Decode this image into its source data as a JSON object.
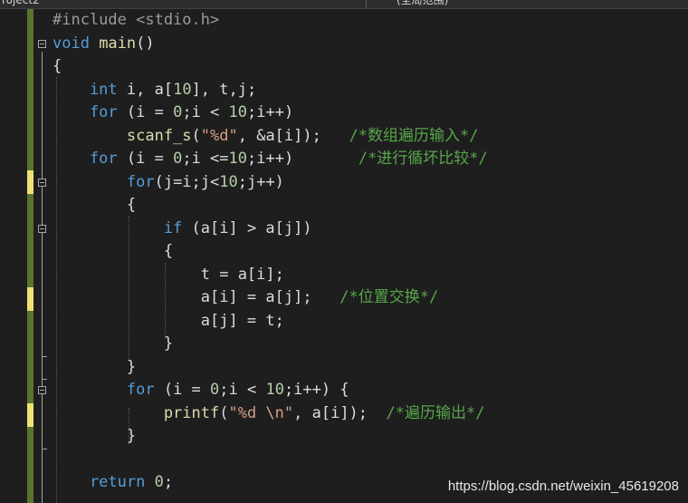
{
  "window": {
    "tab_left": "roject2",
    "tab_right": "(全局范围)"
  },
  "code_lines": [
    [
      {
        "t": "#include <stdio.h>",
        "c": "pp"
      }
    ],
    [
      {
        "t": "void",
        "c": "kw"
      },
      {
        "t": " main",
        "c": "fn"
      },
      {
        "t": "()",
        "c": "var"
      }
    ],
    [
      {
        "t": "{",
        "c": "var"
      }
    ],
    [
      {
        "t": "    int",
        "c": "kw"
      },
      {
        "t": " i, a[",
        "c": "var"
      },
      {
        "t": "10",
        "c": "num"
      },
      {
        "t": "], t,j;",
        "c": "var"
      }
    ],
    [
      {
        "t": "    for",
        "c": "kw"
      },
      {
        "t": " (i = ",
        "c": "var"
      },
      {
        "t": "0",
        "c": "num"
      },
      {
        "t": ";i < ",
        "c": "var"
      },
      {
        "t": "10",
        "c": "num"
      },
      {
        "t": ";i++)",
        "c": "var"
      }
    ],
    [
      {
        "t": "        scanf_s",
        "c": "fn"
      },
      {
        "t": "(",
        "c": "var"
      },
      {
        "t": "\"%d\"",
        "c": "str"
      },
      {
        "t": ", &a[i]);   ",
        "c": "var"
      },
      {
        "t": "/*数组遍历输入*/",
        "c": "com"
      }
    ],
    [
      {
        "t": "    for",
        "c": "kw"
      },
      {
        "t": " (i = ",
        "c": "var"
      },
      {
        "t": "0",
        "c": "num"
      },
      {
        "t": ";i <=",
        "c": "var"
      },
      {
        "t": "10",
        "c": "num"
      },
      {
        "t": ";i++)       ",
        "c": "var"
      },
      {
        "t": "/*进行循坏比较*/",
        "c": "com"
      }
    ],
    [
      {
        "t": "        for",
        "c": "kw"
      },
      {
        "t": "(j=i;j<",
        "c": "var"
      },
      {
        "t": "10",
        "c": "num"
      },
      {
        "t": ";j++)",
        "c": "var"
      }
    ],
    [
      {
        "t": "        {",
        "c": "var"
      }
    ],
    [
      {
        "t": "            if",
        "c": "kw"
      },
      {
        "t": " (a[i] > a[j])",
        "c": "var"
      }
    ],
    [
      {
        "t": "            {",
        "c": "var"
      }
    ],
    [
      {
        "t": "                t = a[i];",
        "c": "var"
      }
    ],
    [
      {
        "t": "                a[i] = a[j];   ",
        "c": "var"
      },
      {
        "t": "/*位置交换*/",
        "c": "com"
      }
    ],
    [
      {
        "t": "                a[j] = t;",
        "c": "var"
      }
    ],
    [
      {
        "t": "            }",
        "c": "var"
      }
    ],
    [
      {
        "t": "        }",
        "c": "var"
      }
    ],
    [
      {
        "t": "        for",
        "c": "kw"
      },
      {
        "t": " (i = ",
        "c": "var"
      },
      {
        "t": "0",
        "c": "num"
      },
      {
        "t": ";i < ",
        "c": "var"
      },
      {
        "t": "10",
        "c": "num"
      },
      {
        "t": ";i++) {",
        "c": "var"
      }
    ],
    [
      {
        "t": "            printf",
        "c": "fn"
      },
      {
        "t": "(",
        "c": "var"
      },
      {
        "t": "\"%d \\n\"",
        "c": "str"
      },
      {
        "t": ", a[i]);  ",
        "c": "var"
      },
      {
        "t": "/*遍历输出*/",
        "c": "com"
      }
    ],
    [
      {
        "t": "        }",
        "c": "var"
      }
    ],
    [
      {
        "t": "",
        "c": "var"
      }
    ],
    [
      {
        "t": "    return",
        "c": "kw"
      },
      {
        "t": " ",
        "c": "var"
      },
      {
        "t": "0",
        "c": "num"
      },
      {
        "t": ";",
        "c": "var"
      }
    ]
  ],
  "watermark": "https://blog.csdn.net/weixin_45619208",
  "colors": {
    "change_saved": "#577430",
    "change_unsaved": "#efe272"
  }
}
